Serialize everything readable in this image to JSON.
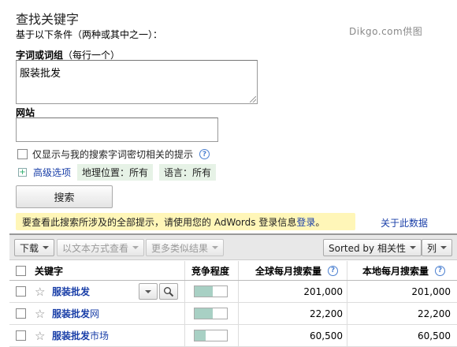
{
  "header": {
    "title": "查找关键字",
    "subtitle": "基于以下条件（两种或其中之一）：",
    "watermark": "Dikgo.com供图"
  },
  "form": {
    "words_label": "字词或词组",
    "words_note": "（每行一个）",
    "words_value": "服装批发",
    "site_label": "网站",
    "site_value": "",
    "checkbox_label": "仅显示与我的搜索字词密切相关的提示",
    "help_glyph": "?",
    "advanced_label": "高级选项",
    "location_chip": "地理位置：所有",
    "language_chip": "语言：所有",
    "search_button": "搜索"
  },
  "notice": {
    "text_before": "要查看此搜索所涉及的全部提示，请使用您的 AdWords 登录信息",
    "link": "登录",
    "text_after": "。",
    "about_link": "关于此数据",
    "about_help": "?"
  },
  "toolbar": {
    "download": "下载",
    "view_as_text": "以文本方式查看",
    "more_like": "更多类似结果",
    "sort": "Sorted by 相关性",
    "columns": "列"
  },
  "table": {
    "headers": {
      "keyword": "关键字",
      "competition": "竞争程度",
      "global": "全球每月搜索量",
      "local": "本地每月搜索量",
      "help": "?"
    },
    "rows": [
      {
        "kw_bold": "服装批发",
        "kw_rest": "",
        "competition": 0.55,
        "global": "201,000",
        "local": "201,000"
      },
      {
        "kw_bold": "服装批发",
        "kw_rest": "网",
        "competition": 0.55,
        "global": "22,200",
        "local": "22,200"
      },
      {
        "kw_bold": "服装批发",
        "kw_rest": "市场",
        "competition": 0.35,
        "global": "60,500",
        "local": "60,500"
      }
    ]
  },
  "icons": {
    "star": "star-outline-icon",
    "magnifier": "magnifier-icon",
    "plus": "expand-plus-icon"
  },
  "colors": {
    "link": "#1a3fa8",
    "notice_bg": "#fff6b8",
    "chip_bg": "#e6f2e6",
    "competition_fill": "#a8d0c4"
  }
}
